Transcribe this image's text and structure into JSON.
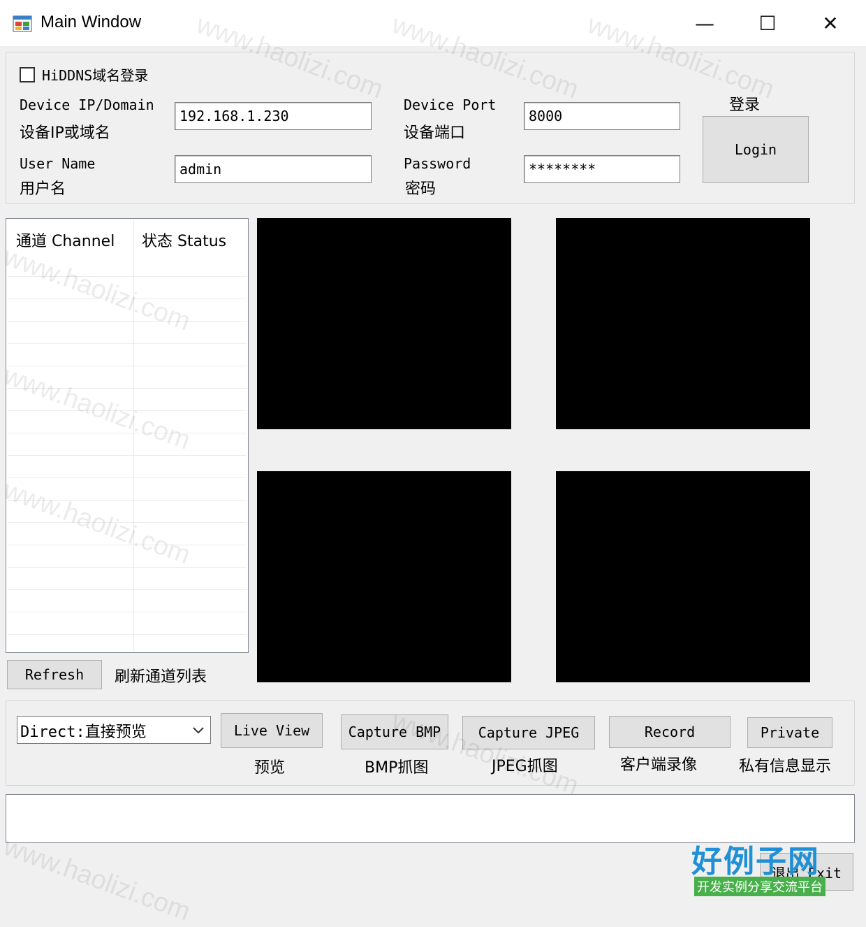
{
  "window": {
    "title": "Main Window",
    "controls": {
      "minimize": "—",
      "maximize": "☐",
      "close": "✕"
    }
  },
  "login_group": {
    "hiddns_label": "HiDDNS域名登录",
    "device_ip_label_en": "Device IP/Domain",
    "device_ip_label_cn": "设备IP或域名",
    "device_ip_value": "192.168.1.230",
    "device_port_label_en": "Device Port",
    "device_port_label_cn": "设备端口",
    "device_port_value": "8000",
    "username_label_en": "User Name",
    "username_label_cn": "用户名",
    "username_value": "admin",
    "password_label_en": "Password",
    "password_label_cn": "密码",
    "password_value": "********",
    "login_label_cn": "登录",
    "login_button": "Login"
  },
  "channel_list": {
    "columns": [
      "通道 Channel",
      "状态 Status"
    ],
    "refresh_button": "Refresh",
    "refresh_label_cn": "刷新通道列表"
  },
  "controls_group": {
    "stream_select_value": "Direct:直接预览",
    "live_view_button": "Live View",
    "live_view_label_cn": "预览",
    "capture_bmp_button": "Capture BMP",
    "capture_bmp_label_cn": "BMP抓图",
    "capture_jpeg_button": "Capture JPEG",
    "capture_jpeg_label_cn": "JPEG抓图",
    "record_button": "Record",
    "record_label_cn": "客户端录像",
    "private_button": "Private",
    "private_label_cn": "私有信息显示"
  },
  "exit_button": "退出 Exit",
  "watermark": {
    "text": "www.haolizi.com",
    "brand": "好例子网",
    "brand_sub": "开发实例分享交流平台"
  },
  "colors": {
    "window_bg": "#f0f0f0",
    "titlebar_bg": "#ffffff",
    "video_bg": "#000000",
    "brand_blue": "#1f8fd6",
    "brand_green": "#48b04a"
  }
}
